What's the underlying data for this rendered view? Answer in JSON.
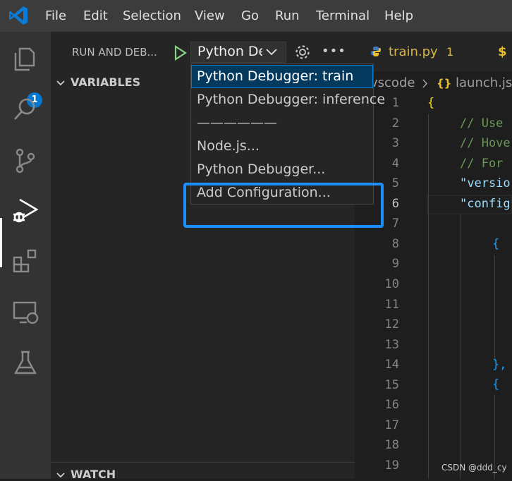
{
  "menu": [
    "File",
    "Edit",
    "Selection",
    "View",
    "Go",
    "Run",
    "Terminal",
    "Help"
  ],
  "activity": {
    "explorer_badge": "1"
  },
  "sidebar": {
    "title": "RUN AND DEB...",
    "config_selected": "Python De",
    "sections": {
      "variables": "VARIABLES",
      "watch": "WATCH"
    }
  },
  "dropdown": {
    "items": [
      "Python Debugger: train",
      "Python Debugger: inference",
      "——————",
      "Node.js...",
      "Python Debugger...",
      "Add Configuration..."
    ]
  },
  "editor": {
    "tabs": [
      {
        "label": "train.py",
        "badge": "1"
      },
      {
        "label": "$"
      }
    ],
    "breadcrumb": {
      "folder": "vscode",
      "file": "launch.json"
    },
    "line_numbers": [
      "1",
      "2",
      "3",
      "4",
      "5",
      "6",
      "7",
      "8",
      "9",
      "10",
      "11",
      "12",
      "13",
      "14",
      "15",
      "16",
      "17",
      "18",
      "19"
    ],
    "lines": {
      "l1": "{",
      "l2": "// Use",
      "l3": "// Hove",
      "l4": "// For",
      "l5": "\"versio",
      "l6": "\"config",
      "l8": "{",
      "l14": "},",
      "l15": "{"
    }
  },
  "watermark": "CSDN @ddd_cy",
  "colors": {
    "accent": "#007fd4",
    "highlight": "#1c8fff",
    "badge": "#0078d4",
    "string": "#9cdcfe",
    "comment": "#6a9955",
    "bracket_gold": "#ffd700",
    "bracket_blue": "#179fff"
  }
}
